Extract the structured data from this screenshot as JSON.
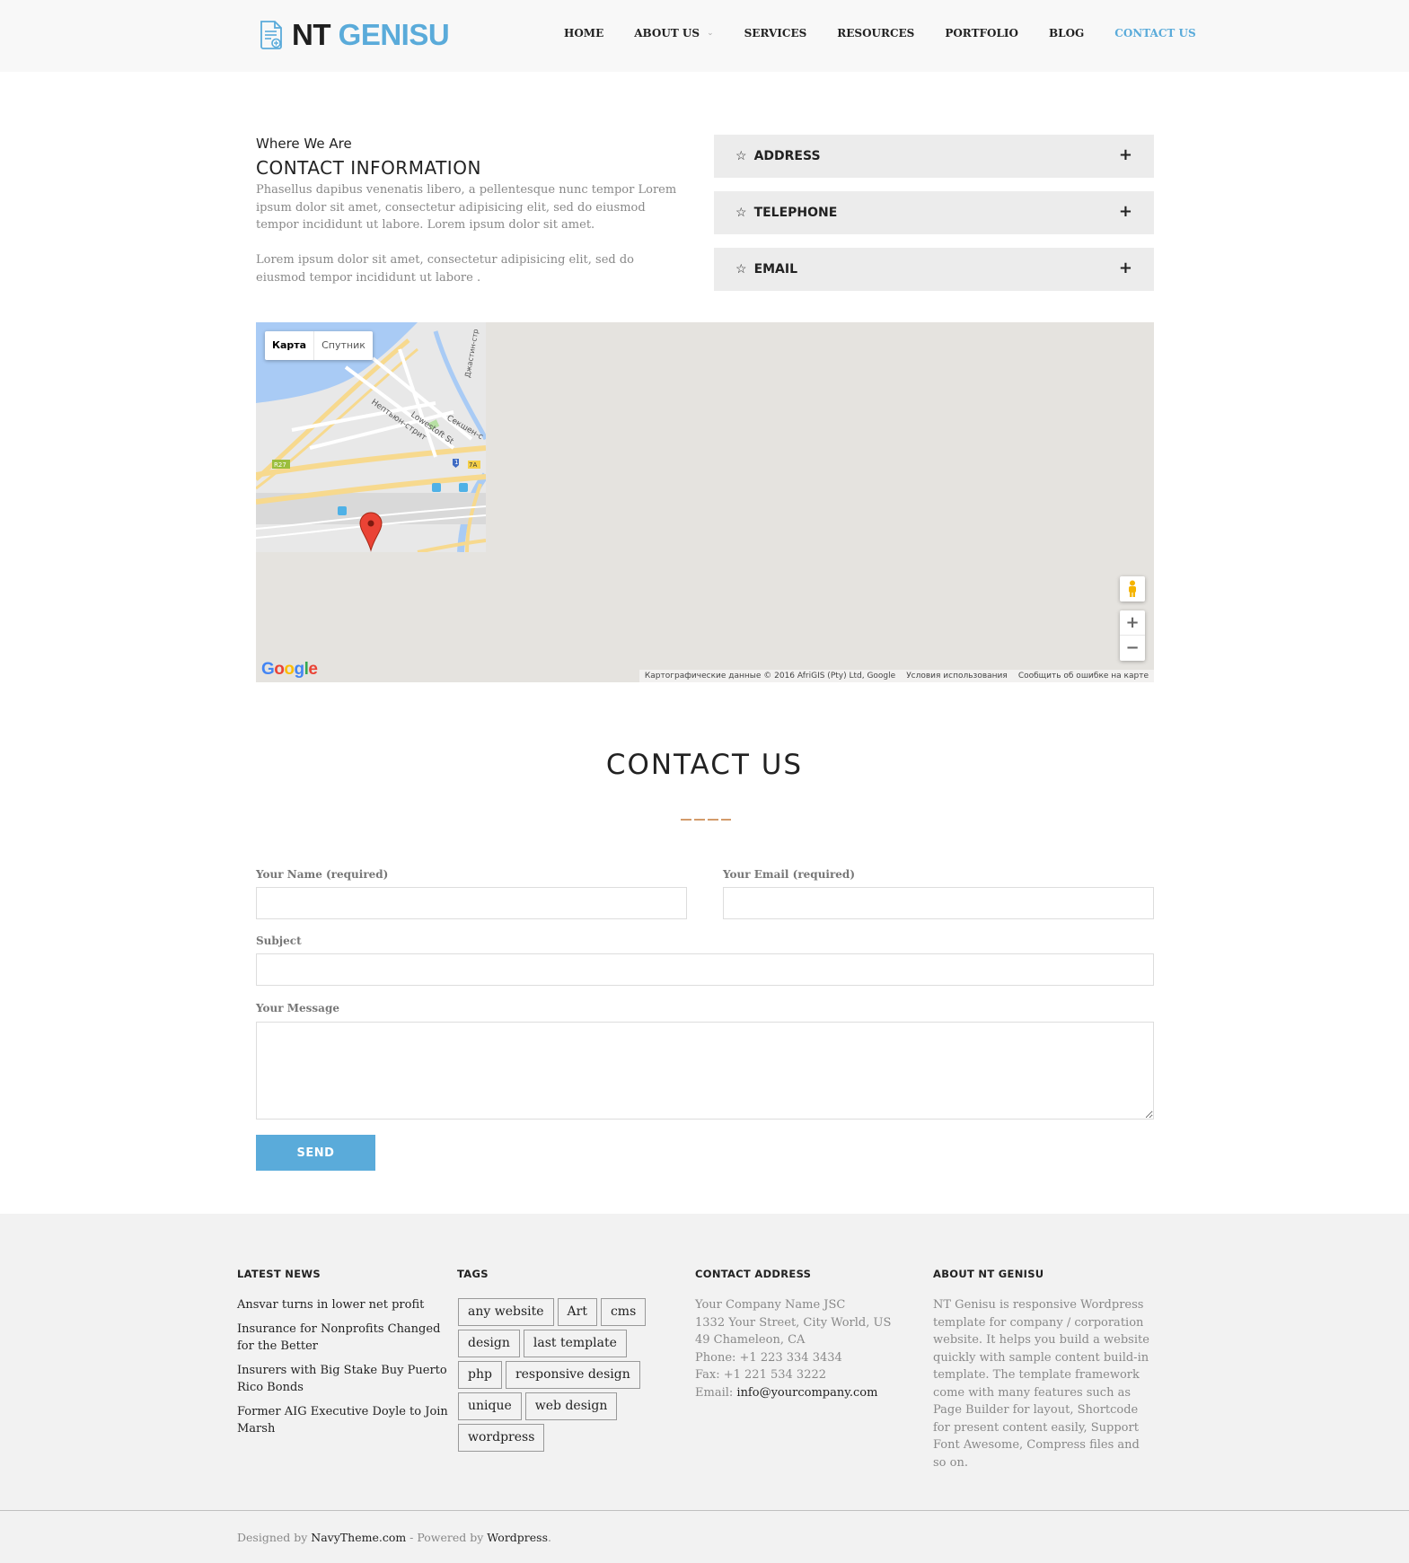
{
  "header": {
    "logo_part1": "NT",
    "logo_part2": "GENISU",
    "nav": [
      {
        "label": "HOME"
      },
      {
        "label": "ABOUT US"
      },
      {
        "label": "SERVICES"
      },
      {
        "label": "RESOURCES"
      },
      {
        "label": "PORTFOLIO"
      },
      {
        "label": "BLOG"
      },
      {
        "label": "CONTACT US",
        "active": true
      }
    ]
  },
  "contact_info": {
    "subtitle": "Where We Are",
    "title": "CONTACT INFORMATION",
    "paragraph1": "Phasellus dapibus venenatis libero, a pellentesque nunc tempor Lorem ipsum dolor sit amet, consectetur adipisicing elit, sed do eiusmod tempor incididunt ut labore. Lorem ipsum dolor sit amet.",
    "paragraph2": "Lorem ipsum dolor sit amet, consectetur adipisicing elit, sed do eiusmod tempor incididunt ut labore .",
    "accordion": [
      {
        "label": "ADDRESS"
      },
      {
        "label": "TELEPHONE"
      },
      {
        "label": "EMAIL"
      }
    ]
  },
  "map": {
    "type_map": "Карта",
    "type_satellite": "Спутник",
    "labels": {
      "street1": "Нептьюн-стрит",
      "street2": "Lowestoft St",
      "street3": "Секшен-с",
      "street4": "Джастин-стр",
      "route1": "R27",
      "route2": "1",
      "route3": "7A"
    },
    "zoom_in": "+",
    "zoom_out": "−",
    "google": [
      "G",
      "o",
      "o",
      "g",
      "l",
      "e"
    ],
    "attribution": "Картографические данные © 2016 AfriGIS (Pty) Ltd, Google",
    "terms": "Условия использования",
    "report": "Сообщить об ошибке на карте"
  },
  "form": {
    "title": "CONTACT US",
    "name_label": "Your Name (required)",
    "email_label": "Your Email (required)",
    "subject_label": "Subject",
    "message_label": "Your Message",
    "name_value": "",
    "email_value": "",
    "subject_value": "",
    "message_value": "",
    "send_label": "SEND"
  },
  "footer": {
    "news_title": "LATEST NEWS",
    "news": [
      "Ansvar turns in lower net profit",
      "Insurance for Nonprofits Changed for the Better",
      "Insurers with Big Stake Buy Puerto Rico Bonds",
      "Former AIG Executive Doyle to Join Marsh"
    ],
    "tags_title": "TAGS",
    "tags": [
      "any website",
      "Art",
      "cms",
      "design",
      "last template",
      "php",
      "responsive design",
      "unique",
      "web design",
      "wordpress"
    ],
    "address_title": "CONTACT ADDRESS",
    "address_lines": [
      "Your Company Name JSC",
      "1332 Your Street, City World, US",
      "49 Chameleon, CA",
      "Phone: +1 223 334 3434",
      "Fax: +1 221 534 3222"
    ],
    "email_prefix": "Email: ",
    "email": "info@yourcompany.com",
    "about_title": "ABOUT NT GENISU",
    "about_text": "NT Genisu is responsive Wordpress template for company / corporation website. It helps you build a website quickly with sample content build-in template. The template framework come with many features such as Page Builder for layout, Shortcode for present content easily, Support Font Awesome, Compress files and so on.",
    "credits_designed": "Designed by ",
    "credits_site": "NavyTheme.com",
    "credits_powered": " - Powered by ",
    "credits_wp": "Wordpress",
    "credits_end": "."
  },
  "colors": {
    "accent": "#5aabda",
    "separator": "#d39b6b",
    "map_marker": "#ea4335"
  }
}
